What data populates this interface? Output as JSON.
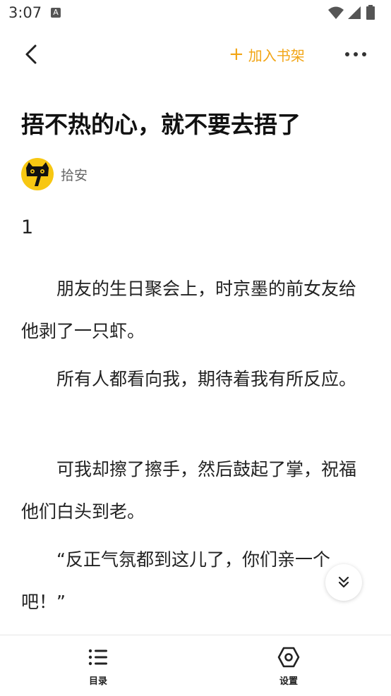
{
  "status_bar": {
    "time": "3:07",
    "notification_letter": "A"
  },
  "header": {
    "add_to_shelf_label": "加入书架"
  },
  "article": {
    "title": "捂不热的心，就不要去捂了",
    "author": "拾安",
    "chapter": "1",
    "paragraphs": [
      "朋友的生日聚会上，时京墨的前女友给他剥了一只虾。",
      "所有人都看向我，期待着我有所反应。",
      "可我却擦了擦手，然后鼓起了掌，祝福他们白头到老。",
      "“反正气氛都到这儿了，你们亲一个吧！”"
    ]
  },
  "bottom_bar": {
    "toc_label": "目录",
    "settings_label": "设置"
  },
  "colors": {
    "accent": "#f2a516",
    "avatar_bg": "#f7c712"
  }
}
